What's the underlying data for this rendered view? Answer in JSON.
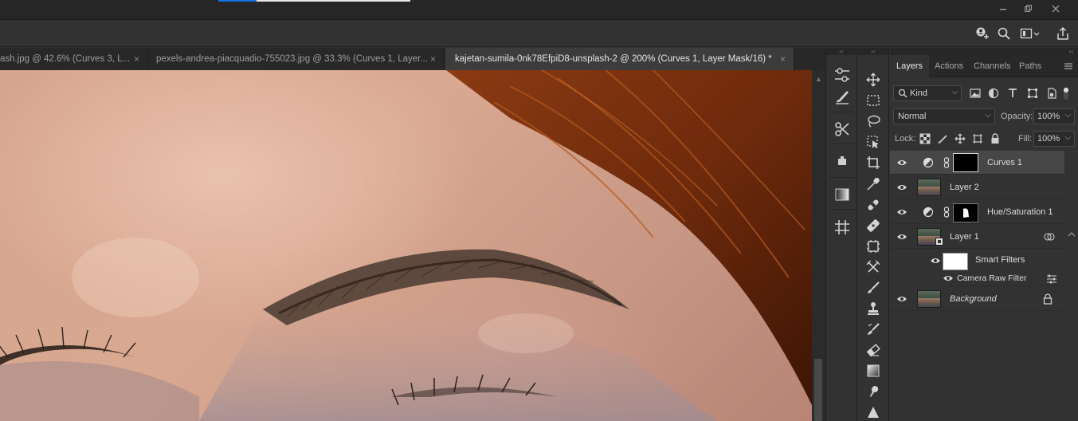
{
  "tabs": [
    {
      "title": "ash.jpg @ 42.6% (Curves 3, L...",
      "close": "×"
    },
    {
      "title": "pexels-andrea-piacquadio-755023.jpg @ 33.3% (Curves 1, Layer...",
      "close": "×"
    },
    {
      "title": "kajetan-sumila-0nk78EfpiD8-unsplash-2 @ 200% (Curves 1, Layer Mask/16) *",
      "close": "×"
    }
  ],
  "collapse_glyph": "‹‹",
  "panel": {
    "tabs": [
      "Layers",
      "Actions",
      "Channels",
      "Paths"
    ],
    "filter": {
      "label": "Kind"
    },
    "blend_mode": "Normal",
    "opacity_label": "Opacity:",
    "opacity_value": "100%",
    "lock_label": "Lock:",
    "fill_label": "Fill:",
    "fill_value": "100%",
    "layers": [
      {
        "name": "Curves 1",
        "type": "adjustment",
        "selected": true
      },
      {
        "name": "Layer 2",
        "type": "pixel"
      },
      {
        "name": "Hue/Saturation 1",
        "type": "adjustment"
      },
      {
        "name": "Layer 1",
        "type": "smart-object"
      },
      {
        "name": "Smart Filters",
        "type": "smart-filters"
      },
      {
        "name": "Camera Raw Filter",
        "type": "filter"
      },
      {
        "name": "Background",
        "type": "background",
        "locked": true
      }
    ]
  },
  "accent_color": "#1473e6"
}
